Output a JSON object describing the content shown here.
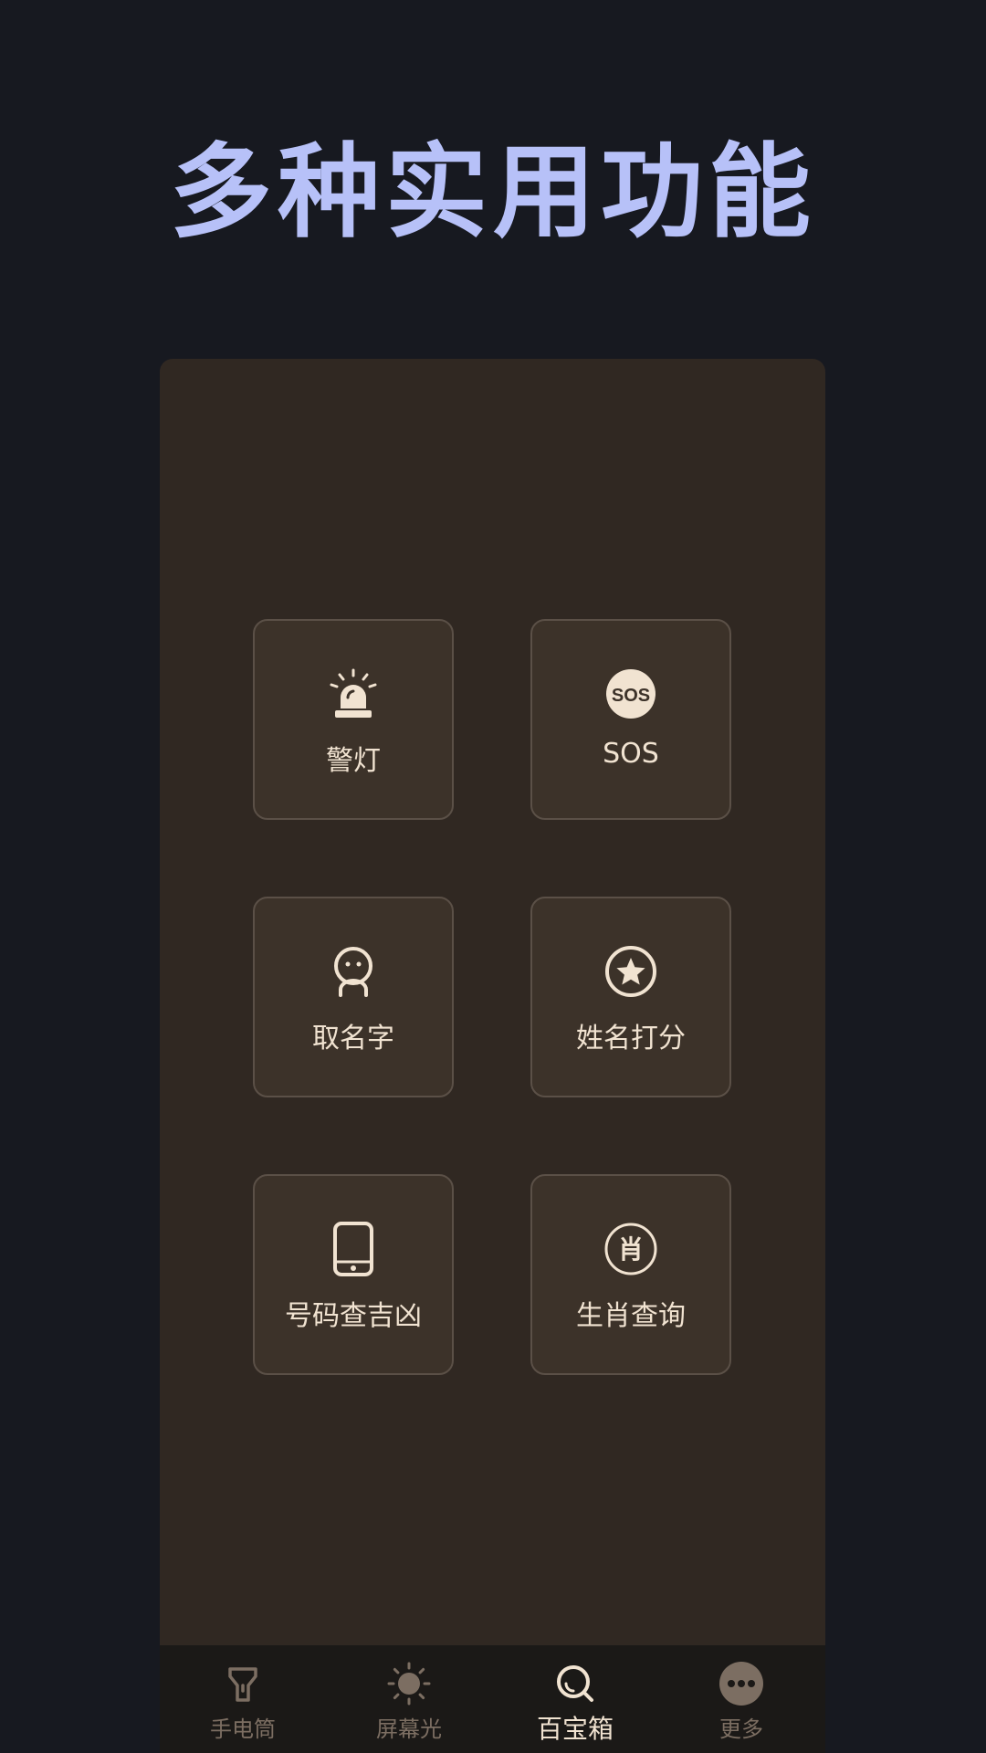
{
  "headline": "多种实用功能",
  "colors": {
    "background": "#171920",
    "headline": "#b7c1f8",
    "panel": "#302822",
    "tile": "#3c3229",
    "tile_border": "#5b5047",
    "accent": "#f1e3d1",
    "tab_inactive": "#7c6e62"
  },
  "tools": [
    {
      "label": "警灯",
      "icon": "siren-icon"
    },
    {
      "label": "SOS",
      "icon": "sos-icon",
      "icon_text": "SOS"
    },
    {
      "label": "取名字",
      "icon": "person-icon"
    },
    {
      "label": "姓名打分",
      "icon": "star-circle-icon"
    },
    {
      "label": "号码查吉凶",
      "icon": "phone-icon"
    },
    {
      "label": "生肖查询",
      "icon": "zodiac-icon",
      "icon_text": "肖"
    }
  ],
  "tabs": [
    {
      "label": "手电筒",
      "icon": "flashlight-icon",
      "active": false
    },
    {
      "label": "屏幕光",
      "icon": "sun-icon",
      "active": false
    },
    {
      "label": "百宝箱",
      "icon": "search-icon",
      "active": true
    },
    {
      "label": "更多",
      "icon": "more-icon",
      "active": false
    }
  ]
}
